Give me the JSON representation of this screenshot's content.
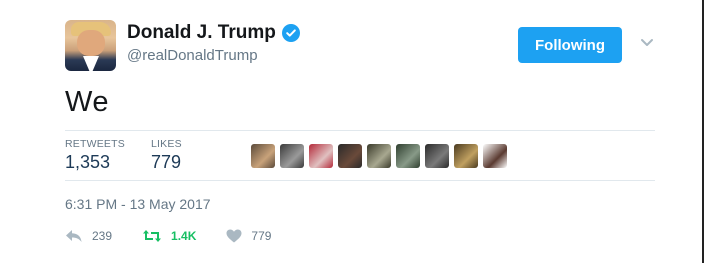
{
  "author": {
    "display_name": "Donald J. Trump",
    "handle": "@realDonaldTrump",
    "verified": true
  },
  "follow_button": {
    "label": "Following",
    "color": "#1da1f2"
  },
  "tweet": {
    "text": "We"
  },
  "stats": {
    "retweets_label": "RETWEETS",
    "retweets_value": "1,353",
    "likes_label": "LIKES",
    "likes_value": "779"
  },
  "likers": [
    {
      "color_a": "#5b4a3a",
      "color_b": "#c8a27a"
    },
    {
      "color_a": "#3a3a3a",
      "color_b": "#9a9a9a"
    },
    {
      "color_a": "#b42a3a",
      "color_b": "#e0c0c0"
    },
    {
      "color_a": "#2a2a2a",
      "color_b": "#6a4a3a"
    },
    {
      "color_a": "#3a3a2a",
      "color_b": "#a8a890"
    },
    {
      "color_a": "#2f3f2f",
      "color_b": "#889a88"
    },
    {
      "color_a": "#2a2a2a",
      "color_b": "#7a7a7a"
    },
    {
      "color_a": "#4a3a20",
      "color_b": "#c0a060"
    },
    {
      "color_a": "#ffffff",
      "color_b": "#5a3a30"
    }
  ],
  "timestamp": "6:31 PM - 13 May 2017",
  "actions": {
    "reply_count": "239",
    "retweet_count": "1.4K",
    "like_count": "779"
  },
  "colors": {
    "accent": "#1da1f2",
    "retweet_green": "#17bf63",
    "muted": "#657786",
    "icon_gray": "#aab8c2"
  }
}
